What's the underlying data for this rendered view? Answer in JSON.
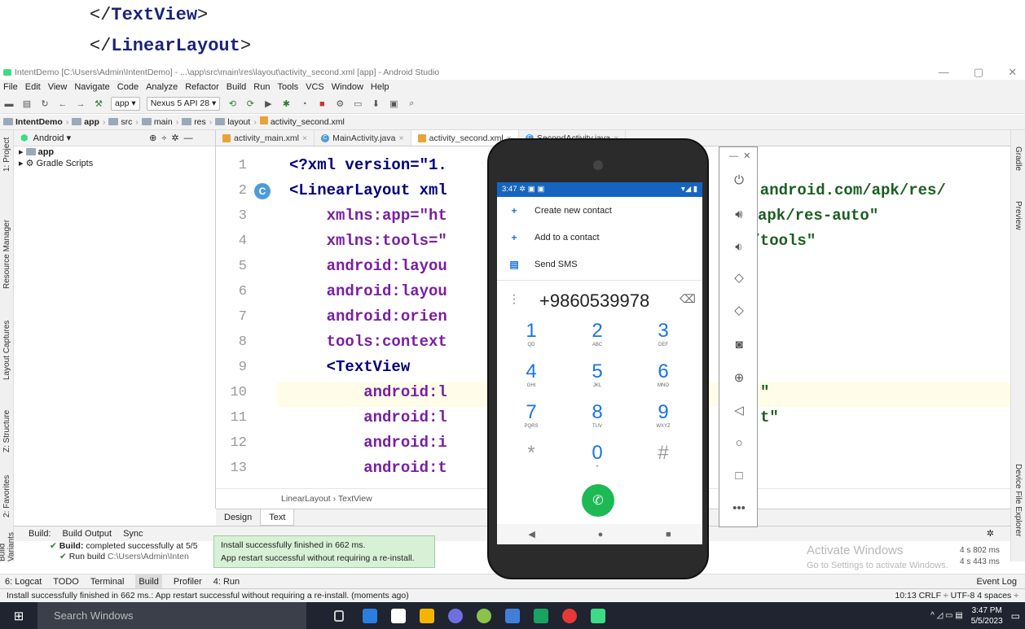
{
  "snippet": {
    "line1_open": "</",
    "line1_tag": "TextView",
    "line1_close": ">",
    "line2_open": "</",
    "line2_tag": "LinearLayout",
    "line2_close": ">"
  },
  "window": {
    "title": "IntentDemo [C:\\Users\\Admin\\IntentDemo] - ...\\app\\src\\main\\res\\layout\\activity_second.xml [app] - Android Studio",
    "min": "—",
    "max": "▢",
    "close": "✕"
  },
  "menu": [
    "File",
    "Edit",
    "View",
    "Navigate",
    "Code",
    "Analyze",
    "Refactor",
    "Build",
    "Run",
    "Tools",
    "VCS",
    "Window",
    "Help"
  ],
  "toolbar": {
    "run_config": "app ▾",
    "device": "Nexus 5 API 28 ▾"
  },
  "breadcrumb": [
    "IntentDemo",
    "app",
    "src",
    "main",
    "res",
    "layout",
    "activity_second.xml"
  ],
  "project": {
    "view_mode": "Android ▾",
    "items": [
      "app",
      "Gradle Scripts"
    ]
  },
  "left_tabs": [
    "1: Project",
    "Resource Manager",
    "Layout Captures",
    "Z: Structure",
    "2: Favorites",
    "Build Variants"
  ],
  "right_tabs": [
    "Gradle",
    "Preview",
    "Device File Explorer"
  ],
  "editor_tabs": [
    {
      "label": "activity_main.xml",
      "type": "xml"
    },
    {
      "label": "MainActivity.java",
      "type": "java"
    },
    {
      "label": "activity_second.xml",
      "type": "xml"
    },
    {
      "label": "SecondActivity.java",
      "type": "java"
    }
  ],
  "code_lines": [
    {
      "n": "1",
      "a": "<?xml version=\"1.",
      "b": "",
      "c": ""
    },
    {
      "n": "2",
      "a": "<LinearLayout xml",
      "b": "",
      "c": "s.android.com/apk/res/"
    },
    {
      "n": "3",
      "a": "    xmlns:app=\"ht",
      "b": "",
      "c": "apk/res-auto\""
    },
    {
      "n": "4",
      "a": "    xmlns:tools=\"",
      "b": "",
      "c": "m/tools\""
    },
    {
      "n": "5",
      "a": "    android:layou",
      "b": "",
      "c": ""
    },
    {
      "n": "6",
      "a": "    android:layou",
      "b": "",
      "c": ""
    },
    {
      "n": "7",
      "a": "    android:orien",
      "b": "",
      "c": ""
    },
    {
      "n": "8",
      "a": "    tools:context",
      "b": "",
      "c": ""
    },
    {
      "n": "9",
      "a": "    <TextView",
      "b": "",
      "c": ""
    },
    {
      "n": "10",
      "a": "        android:l",
      "b": "",
      "c": "\""
    },
    {
      "n": "11",
      "a": "        android:l",
      "b": "",
      "c": "t\""
    },
    {
      "n": "12",
      "a": "        android:i",
      "b": "",
      "c": ""
    },
    {
      "n": "13",
      "a": "        android:t",
      "b": "",
      "c": ""
    }
  ],
  "editor_breadcrumb": "LinearLayout  ›  TextView",
  "design_tabs": [
    "Design",
    "Text"
  ],
  "build": {
    "tabs": [
      "Build:",
      "Build Output",
      "Sync"
    ],
    "line1_strong": "Build:",
    "line1": " completed successfully at 5/5",
    "line2_strong": "Run build",
    "line2": " C:\\Users\\Admin\\Inten",
    "time1": "4 s 802 ms",
    "time2": "4 s 443 ms"
  },
  "toast": {
    "line1": "Install successfully finished in 662 ms.",
    "line2": "App restart successful without requiring a re-install."
  },
  "bottom_tools": [
    "6: Logcat",
    "TODO",
    "Terminal",
    "Build",
    "Profiler",
    "4: Run"
  ],
  "event_log": "Event Log",
  "watermark": {
    "title": "Activate Windows",
    "sub": "Go to Settings to activate Windows."
  },
  "status": {
    "message": "Install successfully finished in 662 ms.: App restart successful without requiring a re-install. (moments ago)",
    "right": "10:13  CRLF ÷  UTF-8  4 spaces ÷"
  },
  "phone": {
    "time": "3:47",
    "suggestions": [
      "Create new contact",
      "Add to a contact",
      "Send SMS"
    ],
    "number": "+9860539978",
    "keys": [
      {
        "d": "1",
        "s": "QD"
      },
      {
        "d": "2",
        "s": "ABC"
      },
      {
        "d": "3",
        "s": "DEF"
      },
      {
        "d": "4",
        "s": "GHI"
      },
      {
        "d": "5",
        "s": "JKL"
      },
      {
        "d": "6",
        "s": "MNO"
      },
      {
        "d": "7",
        "s": "PQRS"
      },
      {
        "d": "8",
        "s": "TUV"
      },
      {
        "d": "9",
        "s": "WXYZ"
      },
      {
        "d": "*",
        "s": ""
      },
      {
        "d": "0",
        "s": "+"
      },
      {
        "d": "#",
        "s": ""
      }
    ]
  },
  "taskbar": {
    "search": "Search Windows",
    "time": "3:47 PM",
    "date": "5/5/2023"
  },
  "colors": {
    "accent": "#1a73e8",
    "call": "#1db954",
    "statusbar": "#1565c0"
  }
}
